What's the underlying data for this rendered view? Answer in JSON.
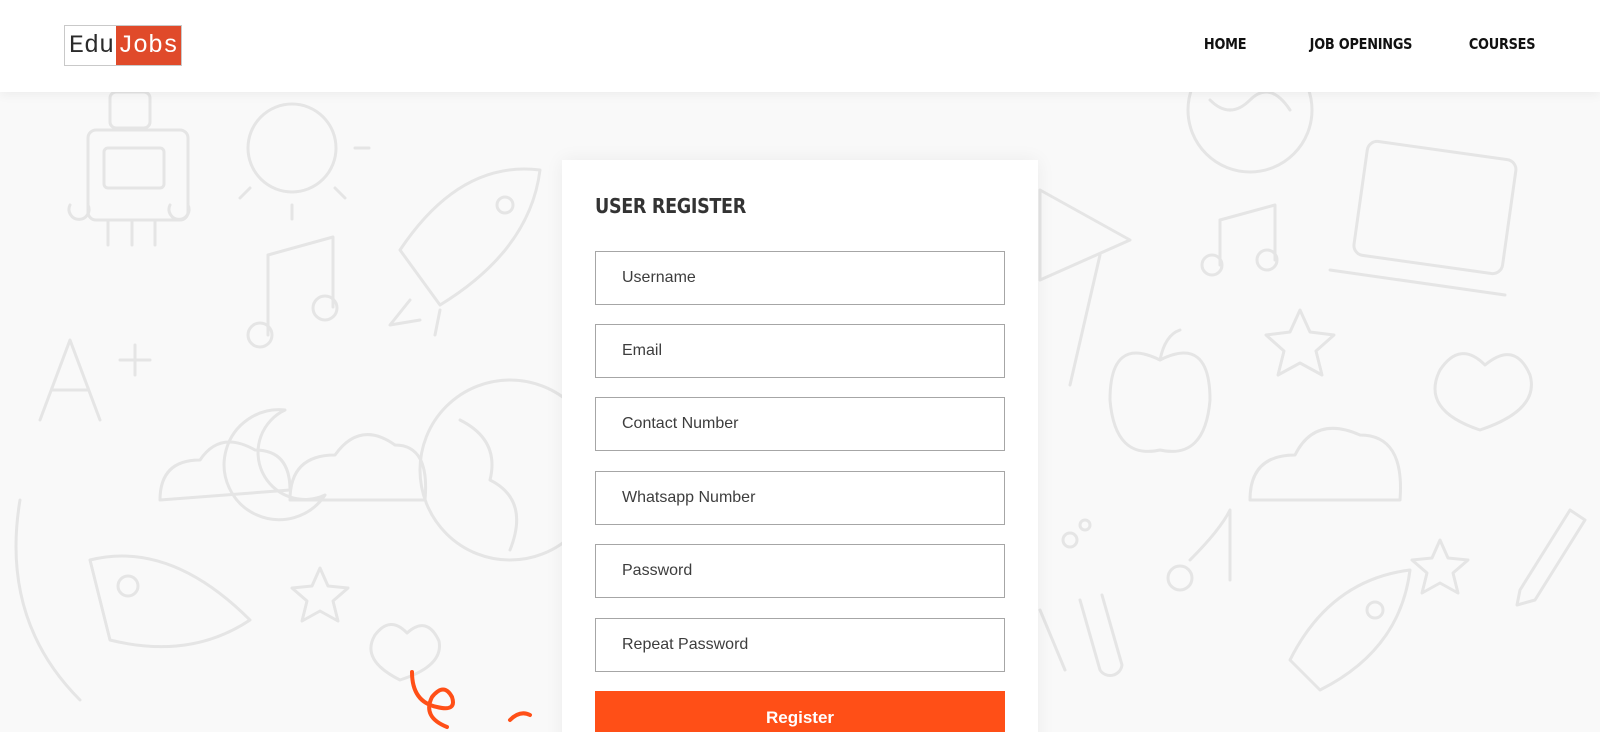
{
  "header": {
    "logo": {
      "part1": "Edu",
      "part2": "Jobs"
    },
    "nav": [
      {
        "label": "HOME"
      },
      {
        "label": "JOB OPENINGS"
      },
      {
        "label": "COURSES"
      }
    ]
  },
  "form": {
    "title": "USER REGISTER",
    "fields": [
      {
        "placeholder": "Username",
        "type": "text"
      },
      {
        "placeholder": "Email",
        "type": "email"
      },
      {
        "placeholder": "Contact Number",
        "type": "tel"
      },
      {
        "placeholder": "Whatsapp Number",
        "type": "tel"
      },
      {
        "placeholder": "Password",
        "type": "password"
      },
      {
        "placeholder": "Repeat Password",
        "type": "password"
      }
    ],
    "submit_label": "Register"
  },
  "colors": {
    "accent": "#ff4f17",
    "logo_red": "#e04a2a",
    "doodle": "#e6e6e6"
  }
}
